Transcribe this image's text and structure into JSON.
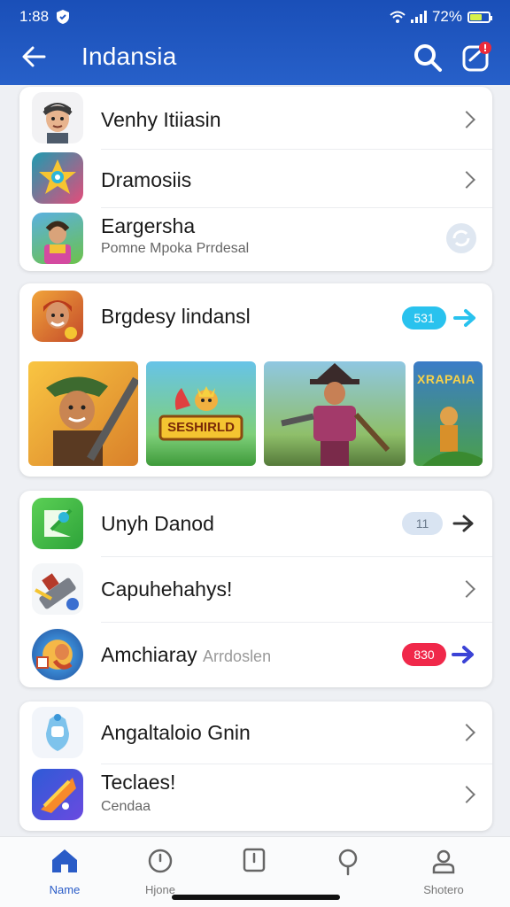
{
  "status": {
    "time": "1:88",
    "battery": "72%"
  },
  "header": {
    "title": "Indansia"
  },
  "card1": {
    "rows": [
      {
        "label": "Venhy Itiiasin"
      },
      {
        "label": "Dramosiis"
      },
      {
        "label": "Eargersha",
        "sub": "Pomne Mpoka Prrdesal"
      }
    ]
  },
  "card2": {
    "title": "Brgdesy lindansl",
    "badge": "531",
    "banner2_text": "SESHIRLD",
    "banner4_text": "XRAPAIA"
  },
  "card3": {
    "rows": [
      {
        "label": "Unyh Danod",
        "badge": "11"
      },
      {
        "label": "Capuhehahys!"
      },
      {
        "label": "Amchiaray",
        "label_faded": "Arrdoslen",
        "badge": "830"
      }
    ]
  },
  "card4": {
    "rows": [
      {
        "label": "Angaltaloio Gnin"
      },
      {
        "label": "Teclaes!",
        "sub": "Cendaa"
      }
    ]
  },
  "bottom_nav": [
    {
      "label": "Name",
      "icon": "home-icon",
      "active": true
    },
    {
      "label": "Hjone",
      "icon": "clock-icon",
      "active": false
    },
    {
      "label": "",
      "icon": "tablet-icon",
      "active": false
    },
    {
      "label": "",
      "icon": "pin-icon",
      "active": false
    },
    {
      "label": "Shotero",
      "icon": "profile-icon",
      "active": false
    }
  ],
  "colors": {
    "header_blue": "#2459c4",
    "badge_cyan": "#29c2ee",
    "badge_red": "#f0284a",
    "badge_grey": "#d9e4f2",
    "nav_active": "#2a5cc7"
  }
}
